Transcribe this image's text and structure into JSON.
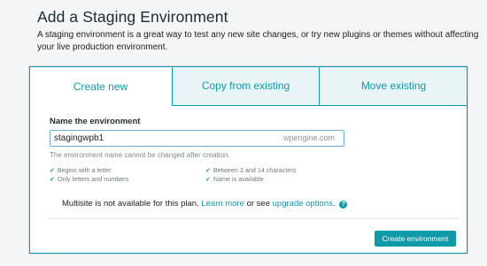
{
  "page": {
    "title": "Add a Staging Environment",
    "description": "A staging environment is a great way to test any new site changes, or try new plugins or themes without affecting your live production environment."
  },
  "tabs": [
    {
      "label": "Create new",
      "active": true
    },
    {
      "label": "Copy from existing",
      "active": false
    },
    {
      "label": "Move existing",
      "active": false
    }
  ],
  "form": {
    "field_label": "Name the environment",
    "env_name_value": "stagingwpb1",
    "domain_suffix": ".wpengine.com",
    "hint": "The environment name cannot be changed after creation.",
    "rules": [
      {
        "text": "Begins with a letter",
        "icon": "check-icon"
      },
      {
        "text": "Only letters and numbers",
        "icon": "check-icon"
      },
      {
        "text": "Between 3 and 14 characters",
        "icon": "check-icon"
      },
      {
        "text": "Name is available",
        "icon": "check-icon"
      }
    ],
    "multisite": {
      "text_before": "Multisite is not available for this plan.",
      "learn_more": "Learn more",
      "text_or_see": "or see",
      "upgrade_options": "upgrade options",
      "period": "."
    },
    "submit_label": "Create environment"
  },
  "colors": {
    "accent": "#0e9aa7",
    "tab_inactive_bg": "#e8f4f5",
    "check": "#27a56a",
    "page_bg": "#f3f5f6"
  }
}
